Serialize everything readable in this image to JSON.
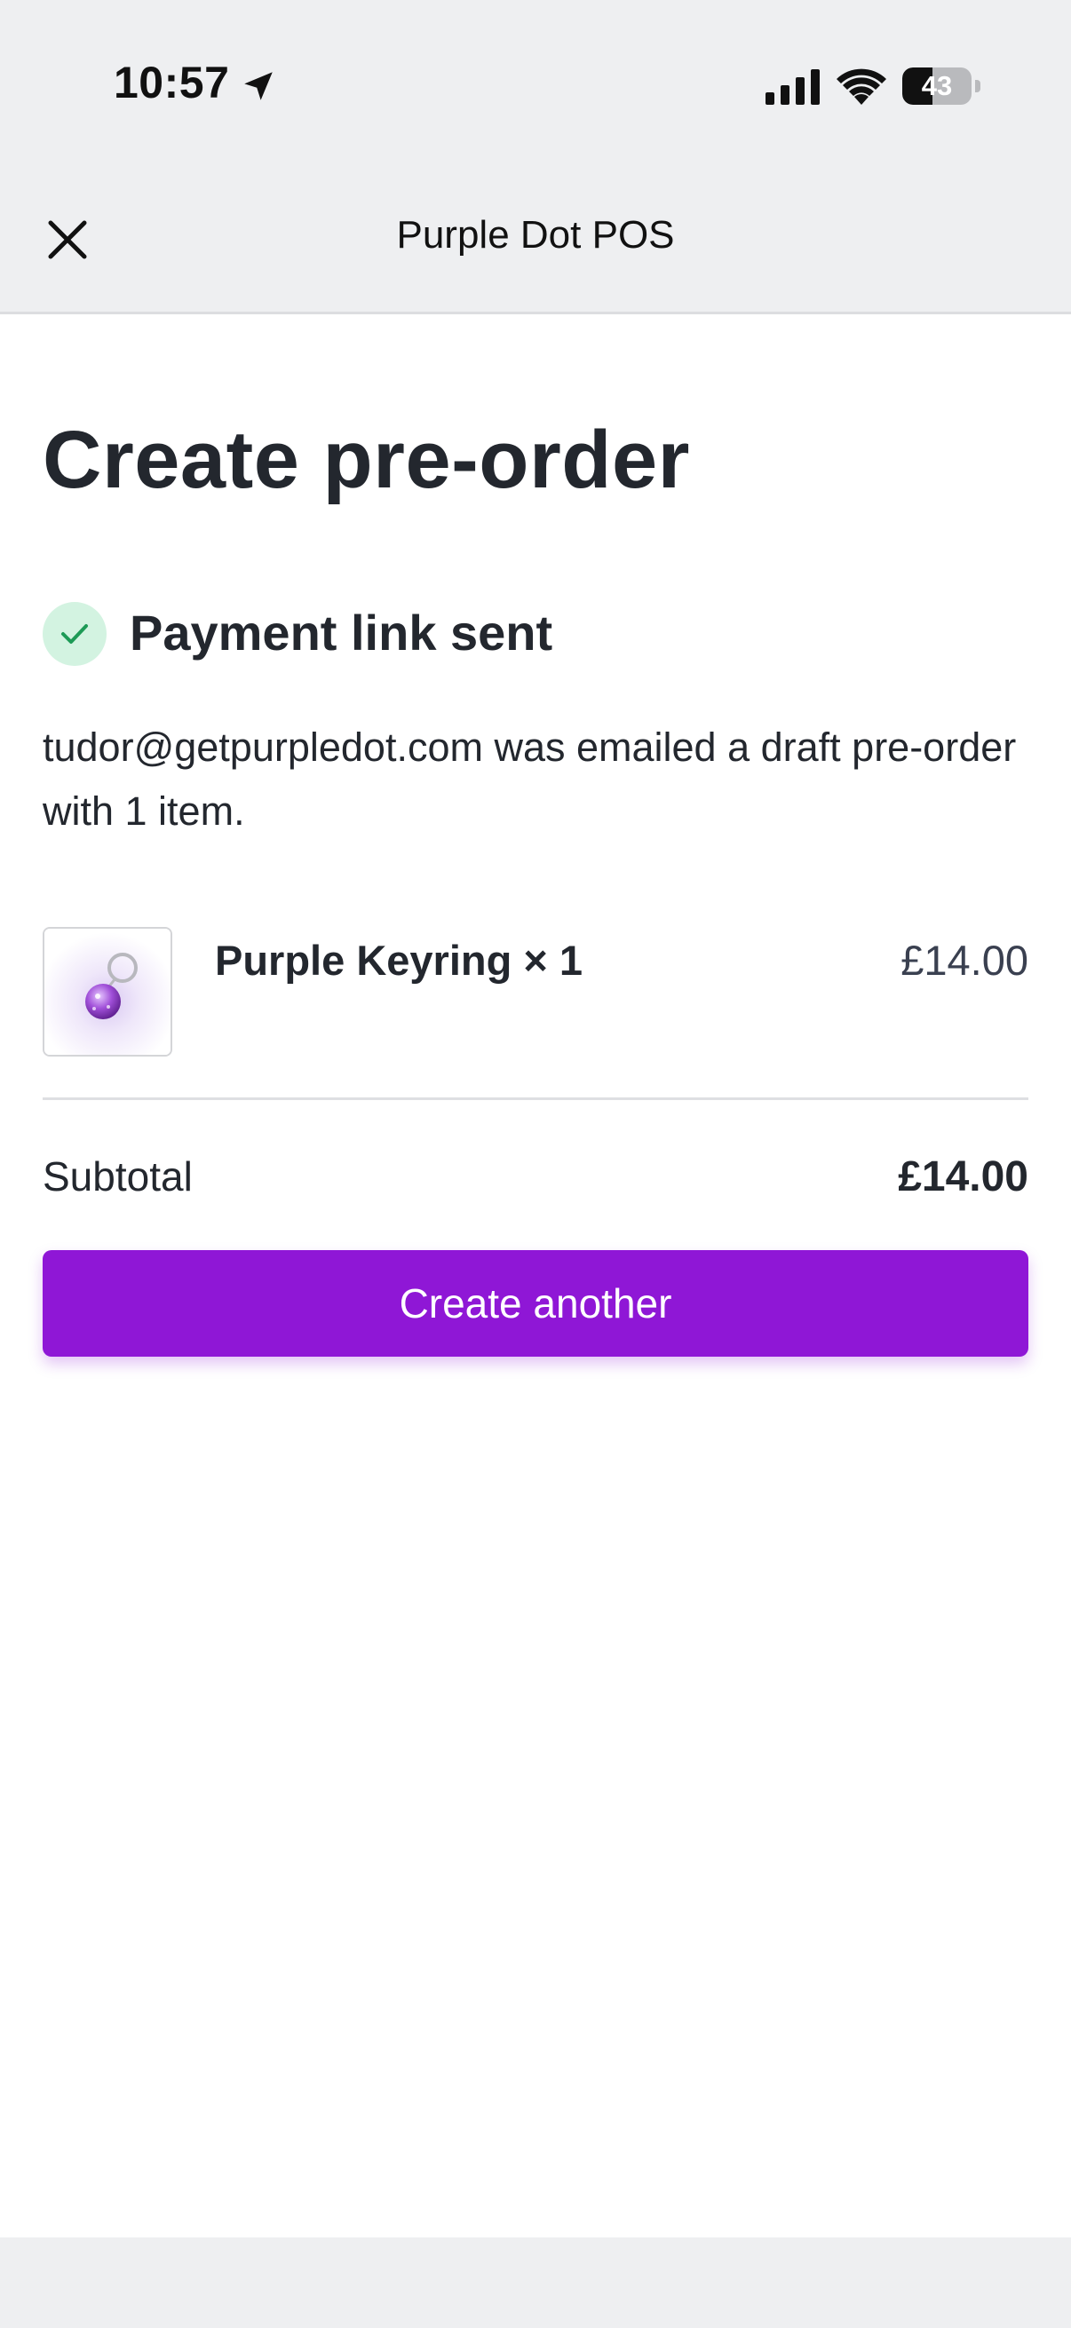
{
  "status_bar": {
    "time": "10:57",
    "battery_level": "43",
    "battery_fraction": 0.43,
    "icons": [
      "location-arrow-icon",
      "cellular-signal-icon",
      "wifi-icon",
      "battery-icon"
    ]
  },
  "header": {
    "title": "Purple Dot POS",
    "close_icon": "close-icon"
  },
  "main": {
    "title": "Create pre-order",
    "success": {
      "icon": "check-icon",
      "text": "Payment link sent"
    },
    "message": "tudor@getpurpledot.com was emailed a draft pre-order with 1 item.",
    "items": [
      {
        "image": "keyring-thumbnail",
        "name": "Purple Keyring × 1",
        "price": "£14.00"
      }
    ],
    "subtotal": {
      "label": "Subtotal",
      "value": "£14.00"
    },
    "button_label": "Create another"
  },
  "colors": {
    "accent": "#8f17d6",
    "success_bg": "#d3f3e1",
    "success_check": "#1d9a56",
    "header_bg": "#eeeff1",
    "text": "#23272e"
  }
}
